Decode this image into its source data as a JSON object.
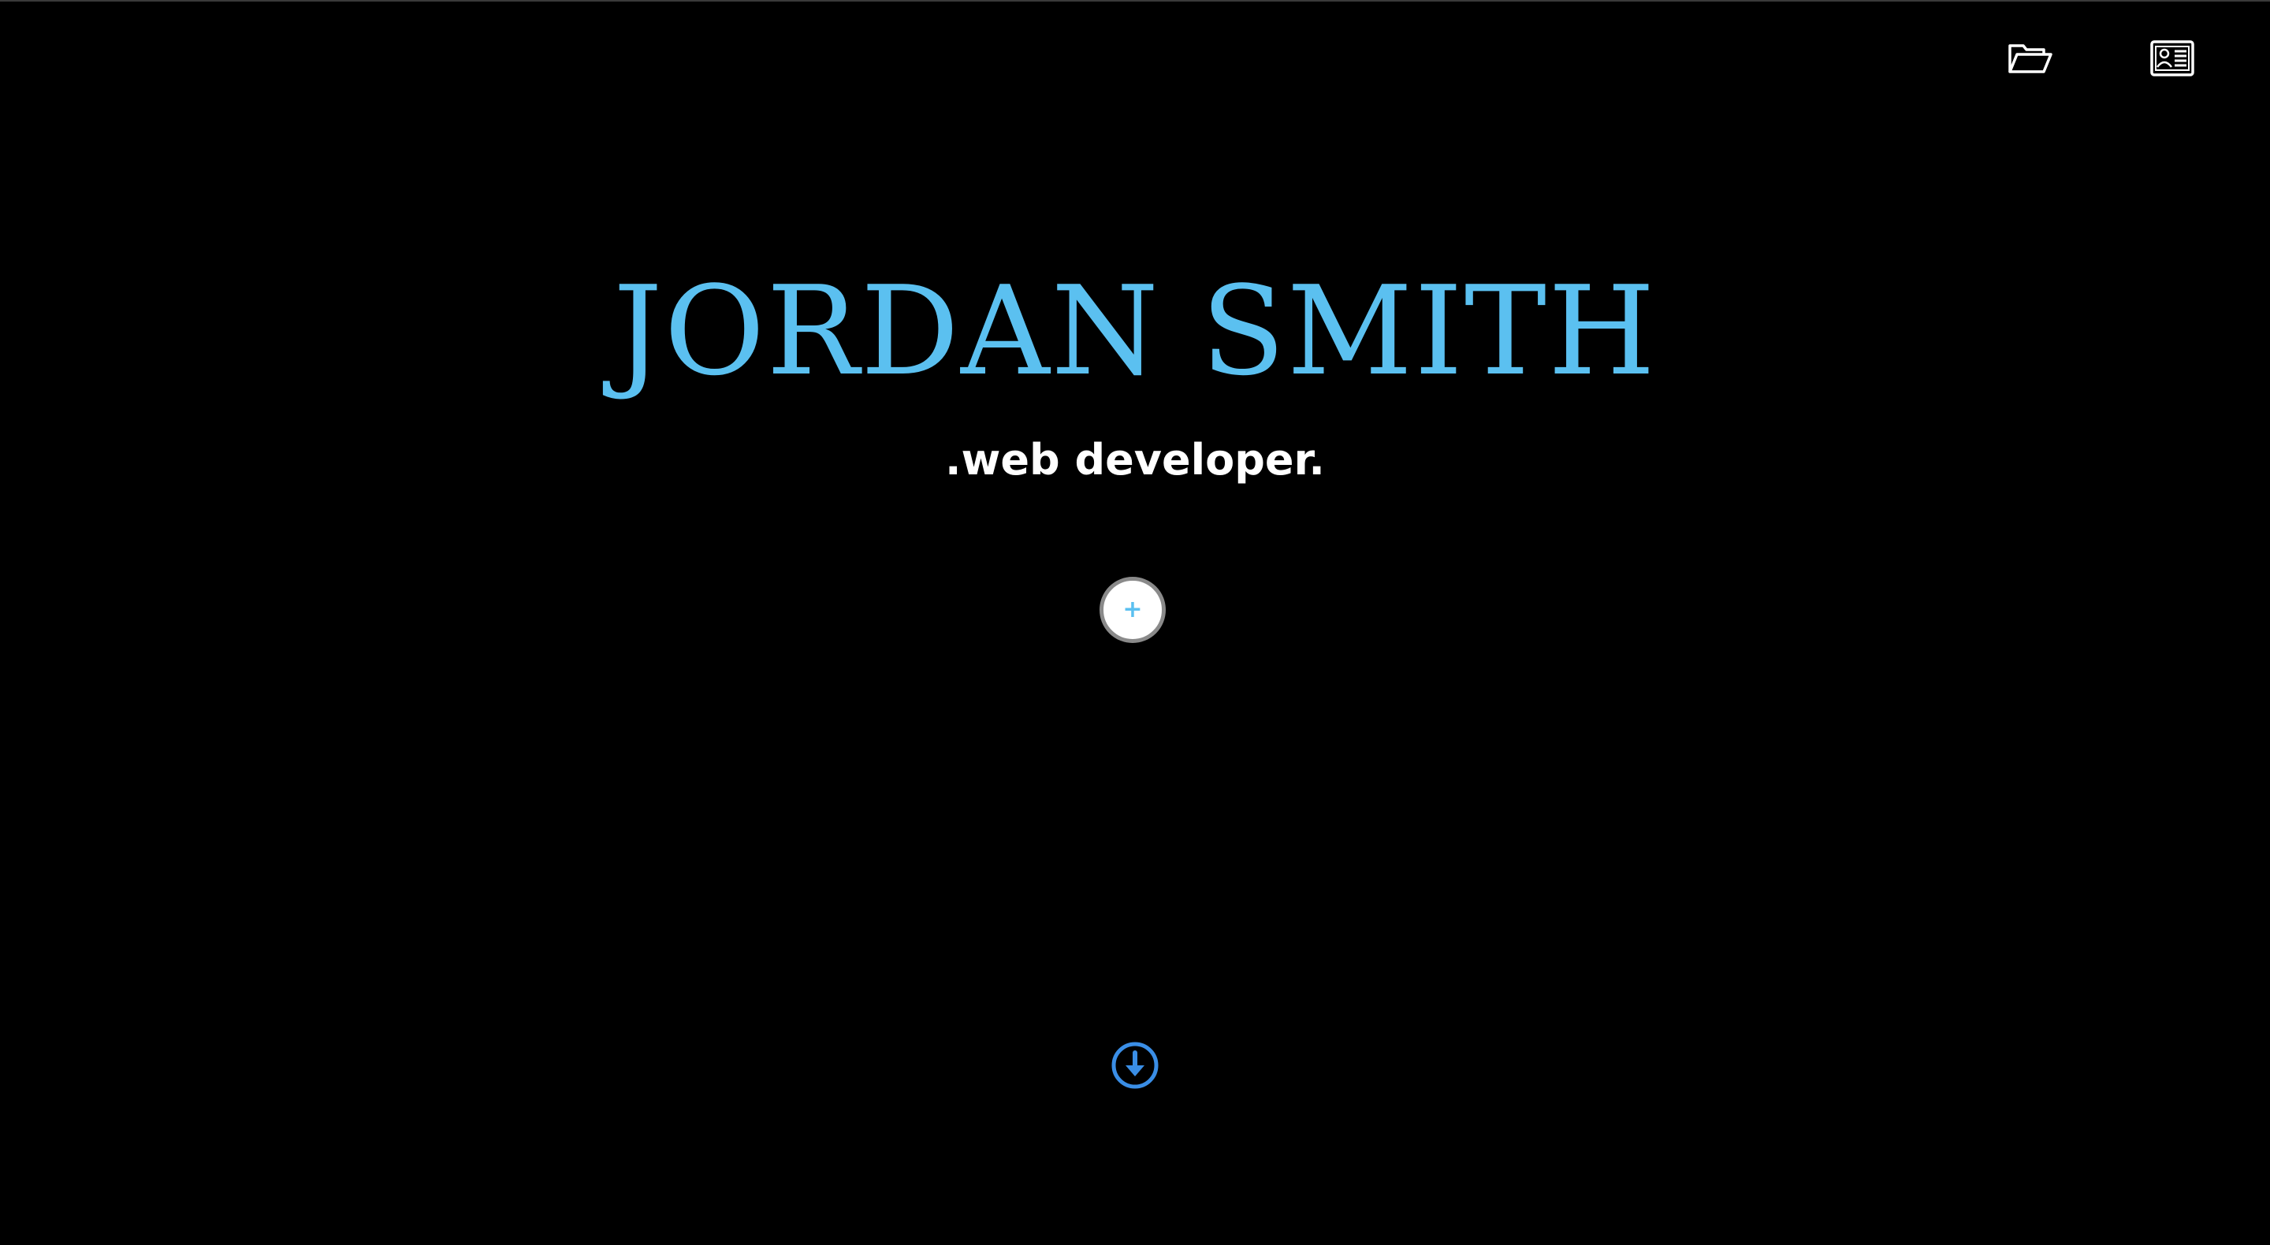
{
  "hero": {
    "name": "JORDAN SMITH",
    "subtitle": ".web developer.",
    "expand_symbol": "+"
  },
  "nav": {
    "icons": [
      "open-folder-icon",
      "contact-card-icon"
    ]
  },
  "scroll": {
    "icon": "arrow-circle-down-icon"
  },
  "colors": {
    "background": "#000000",
    "accent": "#5bc0f0",
    "text": "#ffffff",
    "scroll_icon": "#3a8ee6"
  }
}
